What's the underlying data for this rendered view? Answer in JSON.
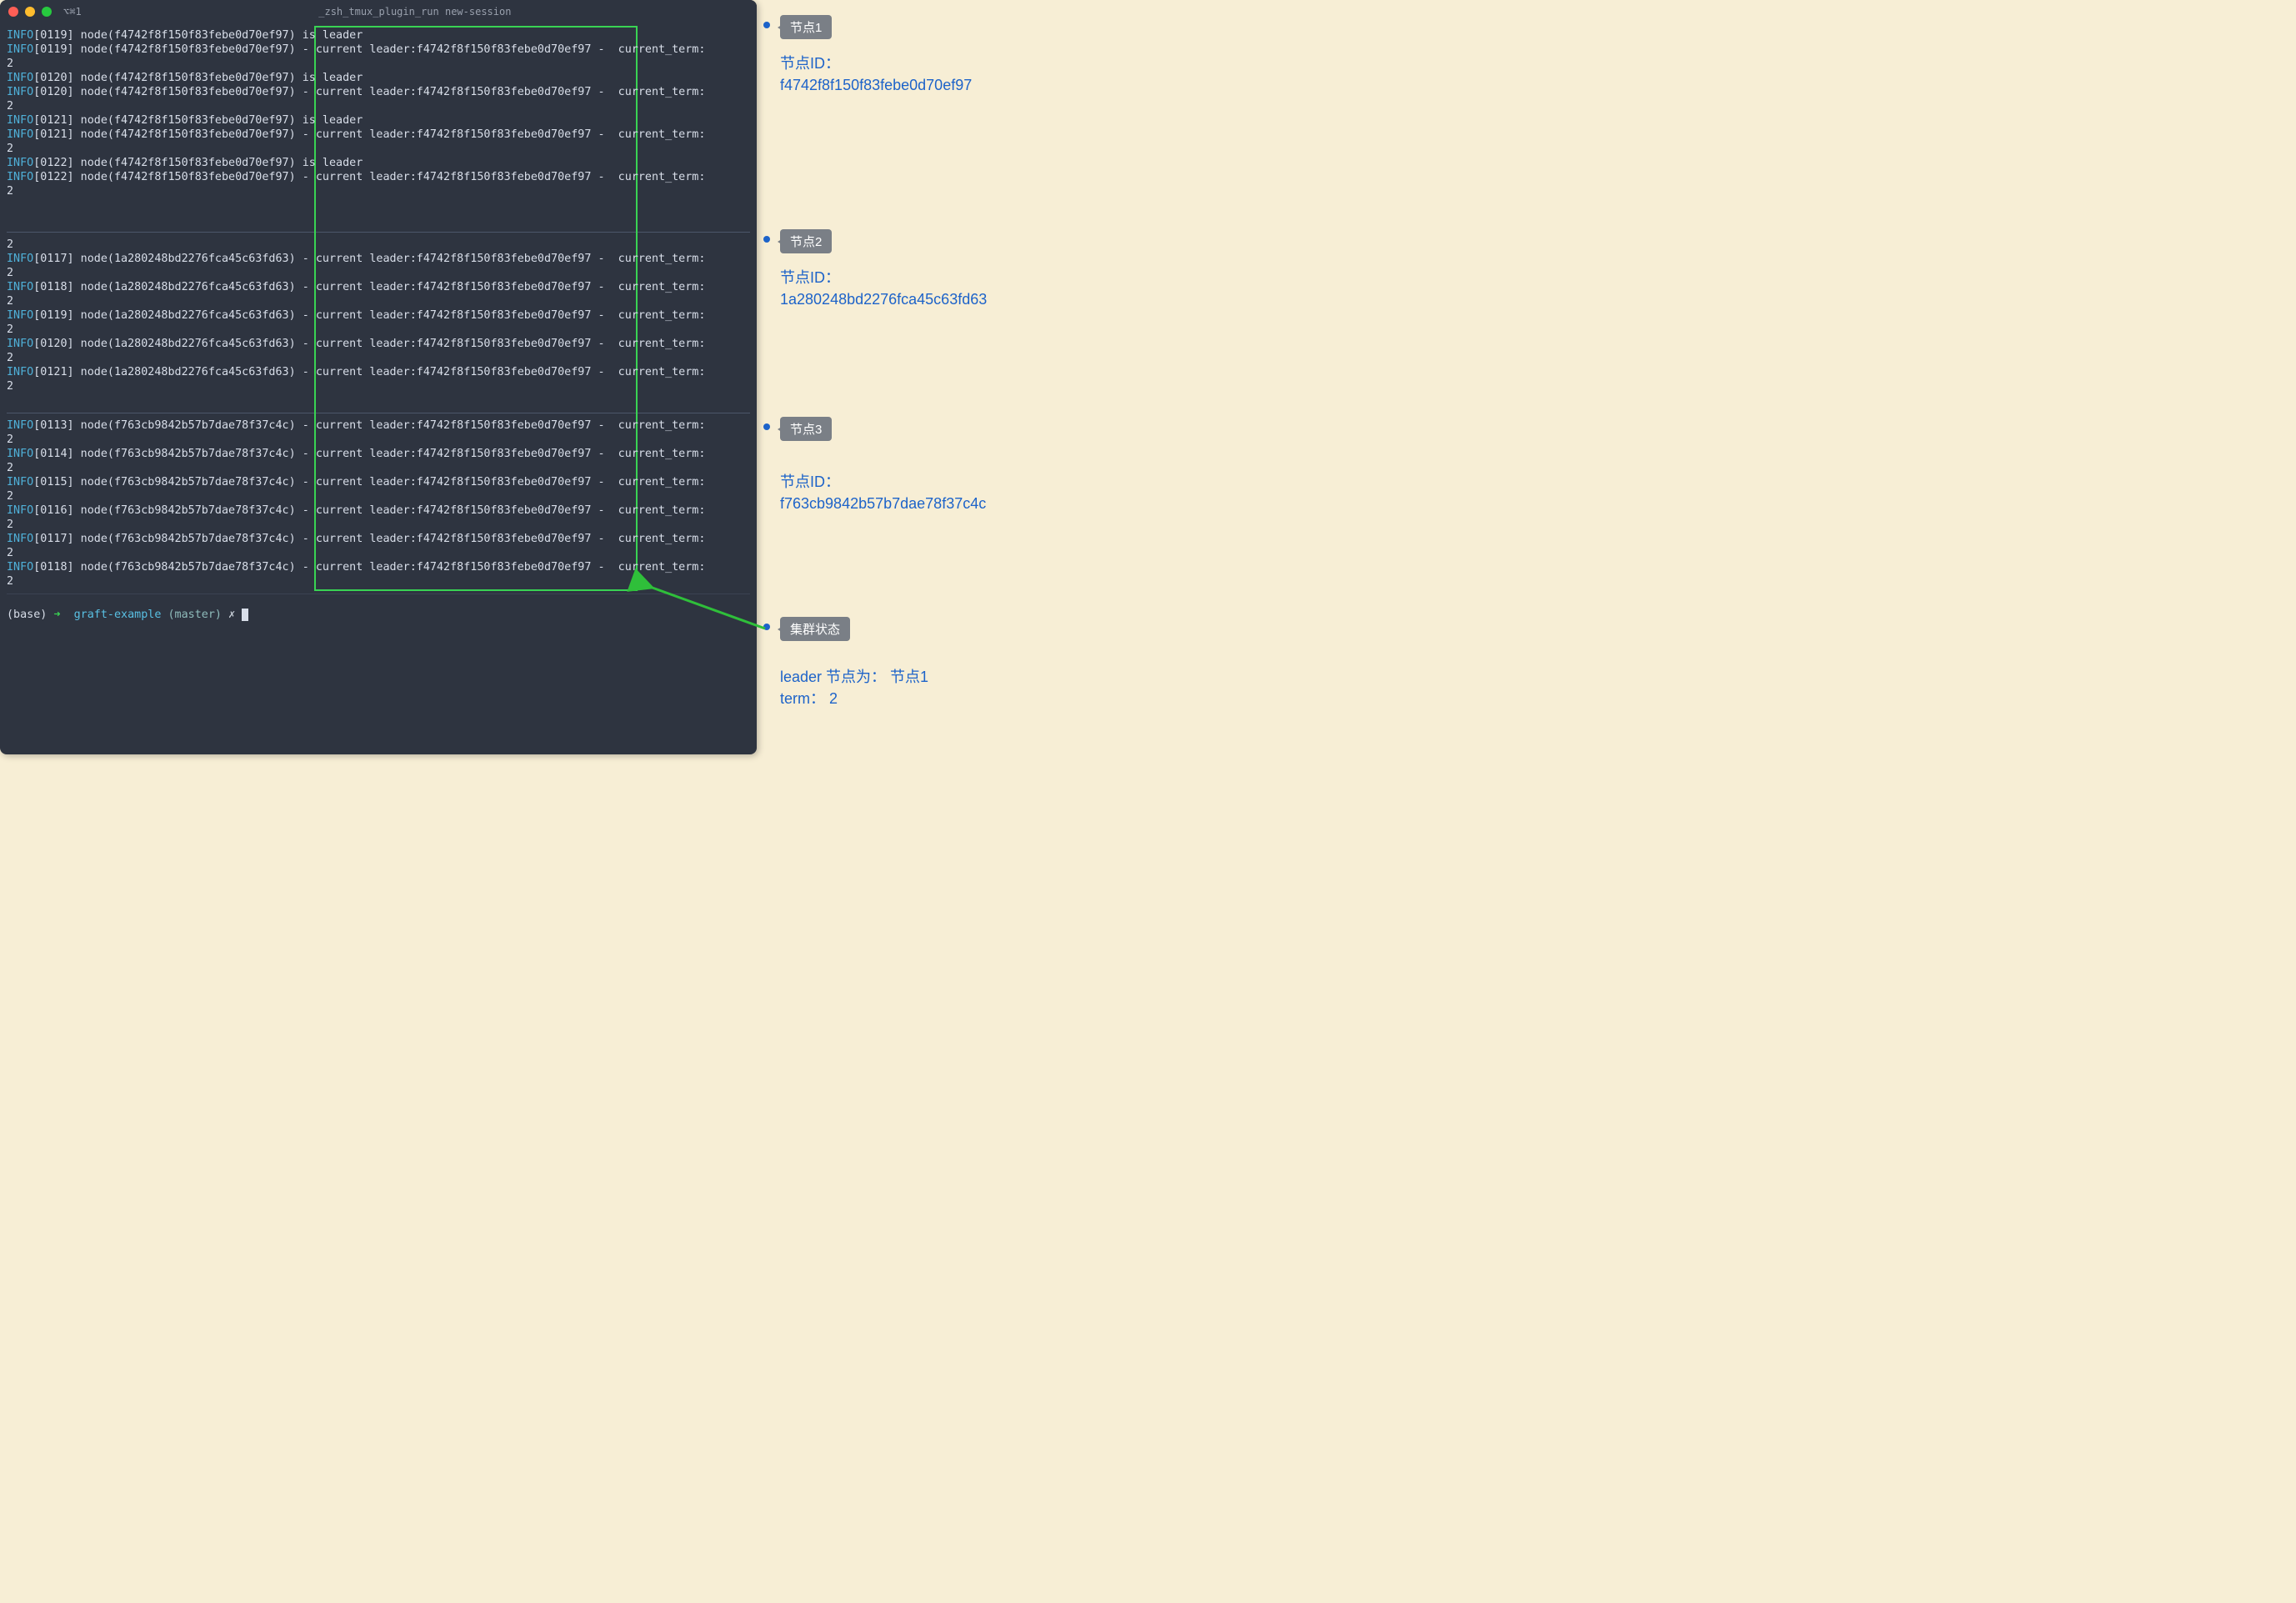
{
  "window": {
    "tab_icon": "⌘1",
    "tab_prefix": "⌥",
    "title": "_zsh_tmux_plugin_run new-session"
  },
  "leader_id": "f4742f8f150f83febe0d70ef97",
  "panes": {
    "p1": {
      "node_id": "f4742f8f150f83febe0d70ef97",
      "lines": [
        {
          "t": "leader",
          "ts": "0119"
        },
        {
          "t": "status",
          "ts": "0119"
        },
        {
          "t": "leader",
          "ts": "0120"
        },
        {
          "t": "status",
          "ts": "0120"
        },
        {
          "t": "leader",
          "ts": "0121"
        },
        {
          "t": "status",
          "ts": "0121"
        },
        {
          "t": "leader",
          "ts": "0122"
        },
        {
          "t": "status",
          "ts": "0122"
        }
      ]
    },
    "p2": {
      "node_id": "1a280248bd2276fca45c63fd63",
      "first_term": "2",
      "lines": [
        {
          "t": "status",
          "ts": "0117"
        },
        {
          "t": "status",
          "ts": "0118"
        },
        {
          "t": "status",
          "ts": "0119"
        },
        {
          "t": "status",
          "ts": "0120"
        },
        {
          "t": "status",
          "ts": "0121"
        }
      ]
    },
    "p3": {
      "node_id": "f763cb9842b57b7dae78f37c4c",
      "lines": [
        {
          "t": "status",
          "ts": "0113"
        },
        {
          "t": "status",
          "ts": "0114"
        },
        {
          "t": "status",
          "ts": "0115"
        },
        {
          "t": "status",
          "ts": "0116"
        },
        {
          "t": "status",
          "ts": "0117"
        },
        {
          "t": "status",
          "ts": "0118"
        }
      ]
    }
  },
  "status_text": {
    "is_leader": "is leader",
    "current_leader_prefix": "- current leader:",
    "current_term": "-  current_term:",
    "term_value": "2"
  },
  "prompt": {
    "base": "(base)",
    "arrow": "➜",
    "repo": "graft-example",
    "branch": "(master)",
    "git_symbol": "✗"
  },
  "annotations": {
    "n1": {
      "tag": "节点1",
      "label": "节点ID：",
      "id": "f4742f8f150f83febe0d70ef97"
    },
    "n2": {
      "tag": "节点2",
      "label": "节点ID：",
      "id": "1a280248bd2276fca45c63fd63"
    },
    "n3": {
      "tag": "节点3",
      "label": "节点ID：",
      "id": "f763cb9842b57b7dae78f37c4c"
    },
    "cluster": {
      "tag": "集群状态",
      "leader_line": "leader 节点为： 节点1",
      "term_line": "term： 2"
    }
  }
}
